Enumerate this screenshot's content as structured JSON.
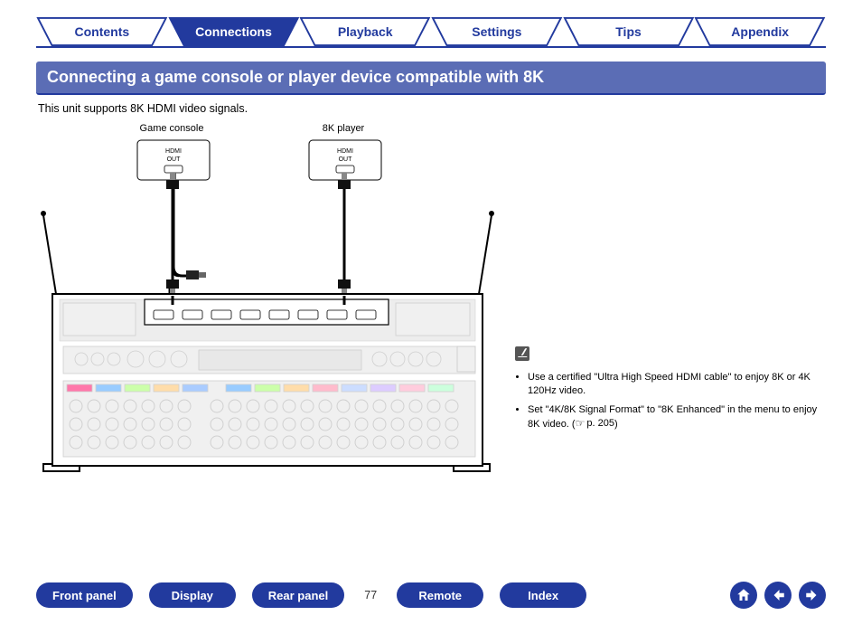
{
  "tabs": {
    "contents": "Contents",
    "connections": "Connections",
    "playback": "Playback",
    "settings": "Settings",
    "tips": "Tips",
    "appendix": "Appendix"
  },
  "page": {
    "title": "Connecting a game console or player device compatible with 8K",
    "intro": "This unit supports 8K HDMI video signals.",
    "number": "77"
  },
  "devices": {
    "game_console": "Game console",
    "player_8k": "8K player",
    "hdmi_out_line1": "HDMI",
    "hdmi_out_line2": "OUT"
  },
  "notes": {
    "b1": "Use a certified \"Ultra High Speed HDMI cable\" to enjoy 8K or 4K 120Hz video.",
    "b2_pre": "Set \"4K/8K Signal Format\" to \"8K Enhanced\" in the menu to enjoy 8K video.  (",
    "b2_ref": "p. 205",
    "b2_post": ")"
  },
  "bottom": {
    "front_panel": "Front panel",
    "display": "Display",
    "rear_panel": "Rear panel",
    "remote": "Remote",
    "index": "Index"
  }
}
